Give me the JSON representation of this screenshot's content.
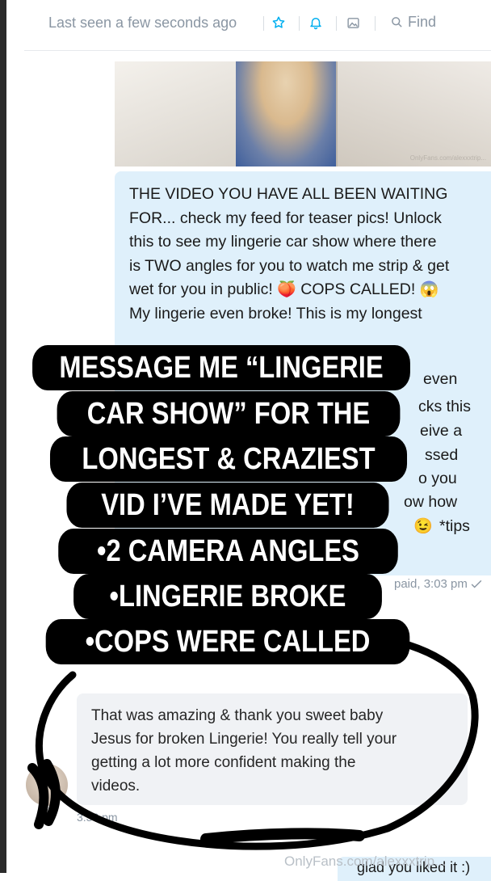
{
  "header": {
    "status": "Last seen a few seconds ago",
    "find_label": "Find",
    "icons": [
      "star-icon",
      "bell-icon",
      "image-icon",
      "search-icon"
    ]
  },
  "photo": {
    "watermark": "OnlyFans.com/alexxxtrip..."
  },
  "sent_message": {
    "line1": "THE VIDEO YOU HAVE ALL BEEN WAITING",
    "line2": "FOR... check my feed for teaser pics! Unlock",
    "line3": "this to see my lingerie car show where there",
    "line4": "is TWO angles for you to watch me strip & get",
    "line5a": "wet for you in public!",
    "line5b": "COPS CALLED!",
    "line6": "My lingerie even broke! This is my longest",
    "right1": "even",
    "right2": "cks this",
    "right3": "eive a",
    "right4": "ssed",
    "right5": "o you",
    "right6": "ow how",
    "right7": "*tips",
    "paid": "paid, 3:03 pm"
  },
  "received_message": {
    "line1": "That was amazing & thank you sweet baby",
    "line2": "Jesus for broken Lingerie! You really tell your",
    "line3": "getting a lot more confident making the",
    "line4": "videos.",
    "time": "3:36 pm"
  },
  "overlay": {
    "lines": [
      "MESSAGE ME “LINGERIE",
      "CAR SHOW” FOR THE",
      "LONGEST & CRAZIEST",
      "VID I’VE MADE YET!",
      "•2 CAMERA ANGLES",
      "•LINGERIE BROKE",
      "•COPS WERE CALLED"
    ]
  },
  "footer": {
    "watermark": "OnlyFans.com/alexxxtrip...",
    "last_bubble": "glad you liked it :)"
  },
  "colors": {
    "sent_bubble": "#dff0fb",
    "received_bubble": "#f0f2f5",
    "meta_text": "#8a96a3",
    "accent": "#00aff0"
  }
}
